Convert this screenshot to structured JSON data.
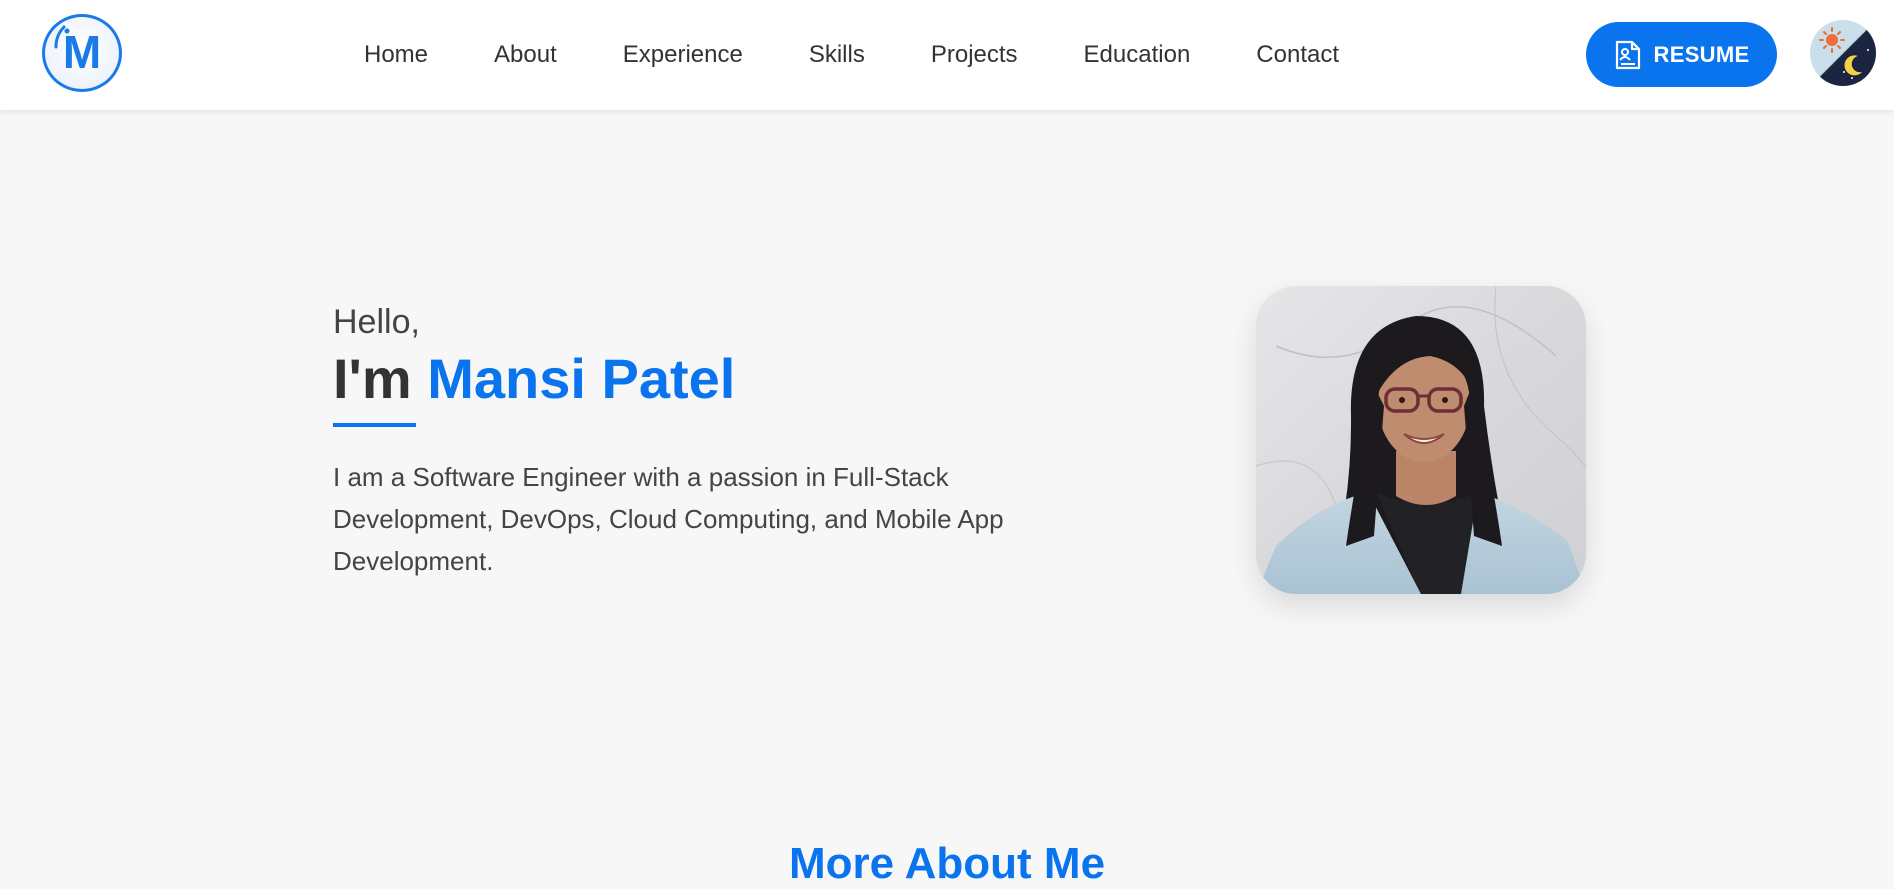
{
  "header": {
    "logo_letter": "M",
    "nav": [
      "Home",
      "About",
      "Experience",
      "Skills",
      "Projects",
      "Education",
      "Contact"
    ],
    "resume_label": "RESUME",
    "theme_toggle_icon": "sun-moon-icon"
  },
  "hero": {
    "greeting": "Hello,",
    "headline_prefix": "I'm",
    "name": "Mansi Patel",
    "intro": "I am a Software Engineer with a passion in Full-Stack Development, DevOps, Cloud Computing, and Mobile App Development."
  },
  "about": {
    "section_title": "More About Me"
  },
  "colors": {
    "accent": "#0a74ee",
    "page_bg": "#f7f7f7",
    "header_bg": "#ffffff",
    "text": "#333333"
  }
}
